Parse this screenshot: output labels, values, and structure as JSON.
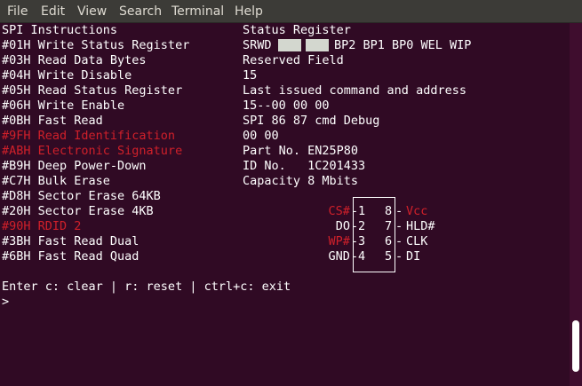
{
  "menu": [
    "File",
    "Edit",
    "View",
    "Search",
    "Terminal",
    "Help"
  ],
  "left": [
    {
      "text": "SPI Instructions",
      "red": false
    },
    {
      "text": "#01H Write Status Register",
      "red": false
    },
    {
      "text": "#03H Read Data Bytes",
      "red": false
    },
    {
      "text": "#04H Write Disable",
      "red": false
    },
    {
      "text": "#05H Read Status Register",
      "red": false
    },
    {
      "text": "#06H Write Enable",
      "red": false
    },
    {
      "text": "#0BH Fast Read",
      "red": false
    },
    {
      "text": "#9FH Read Identification",
      "red": true
    },
    {
      "text": "#ABH Electronic Signature",
      "red": true
    },
    {
      "text": "#B9H Deep Power-Down",
      "red": false
    },
    {
      "text": "#C7H Bulk Erase",
      "red": false
    },
    {
      "text": "#D8H Sector Erase 64KB",
      "red": false
    },
    {
      "text": "#20H Sector Erase 4KB",
      "red": false
    },
    {
      "text": "#90H RDID 2",
      "red": true
    },
    {
      "text": "#3BH Fast Read Dual",
      "red": false
    },
    {
      "text": "#6BH Fast Read Quad",
      "red": false
    }
  ],
  "right": {
    "heading": "Status Register",
    "srwd_label": "SRWD",
    "status_bits": "BP2 BP1 BP0 WEL WIP",
    "reserved": "Reserved Field",
    "line3": "15",
    "line4": "Last issued command and address",
    "line5": "15--00 00 00",
    "line6": "SPI 86 87 cmd Debug",
    "line7": "00 00",
    "line8": "Part No. EN25P80",
    "line9": "ID No.   1C201433",
    "line10": "Capacity 8 Mbits"
  },
  "pins": {
    "left": [
      {
        "name": "CS#",
        "num": "1",
        "red": true
      },
      {
        "name": "DO",
        "num": "2",
        "red": false
      },
      {
        "name": "WP#",
        "num": "3",
        "red": true
      },
      {
        "name": "GND",
        "num": "4",
        "red": false
      }
    ],
    "right": [
      {
        "name": "Vcc",
        "num": "8",
        "red": true
      },
      {
        "name": "HLD#",
        "num": "7",
        "red": false
      },
      {
        "name": "CLK",
        "num": "6",
        "red": false
      },
      {
        "name": "DI",
        "num": "5",
        "red": false
      }
    ]
  },
  "help": "Enter c: clear | r: reset | ctrl+c: exit",
  "prompt": ">"
}
